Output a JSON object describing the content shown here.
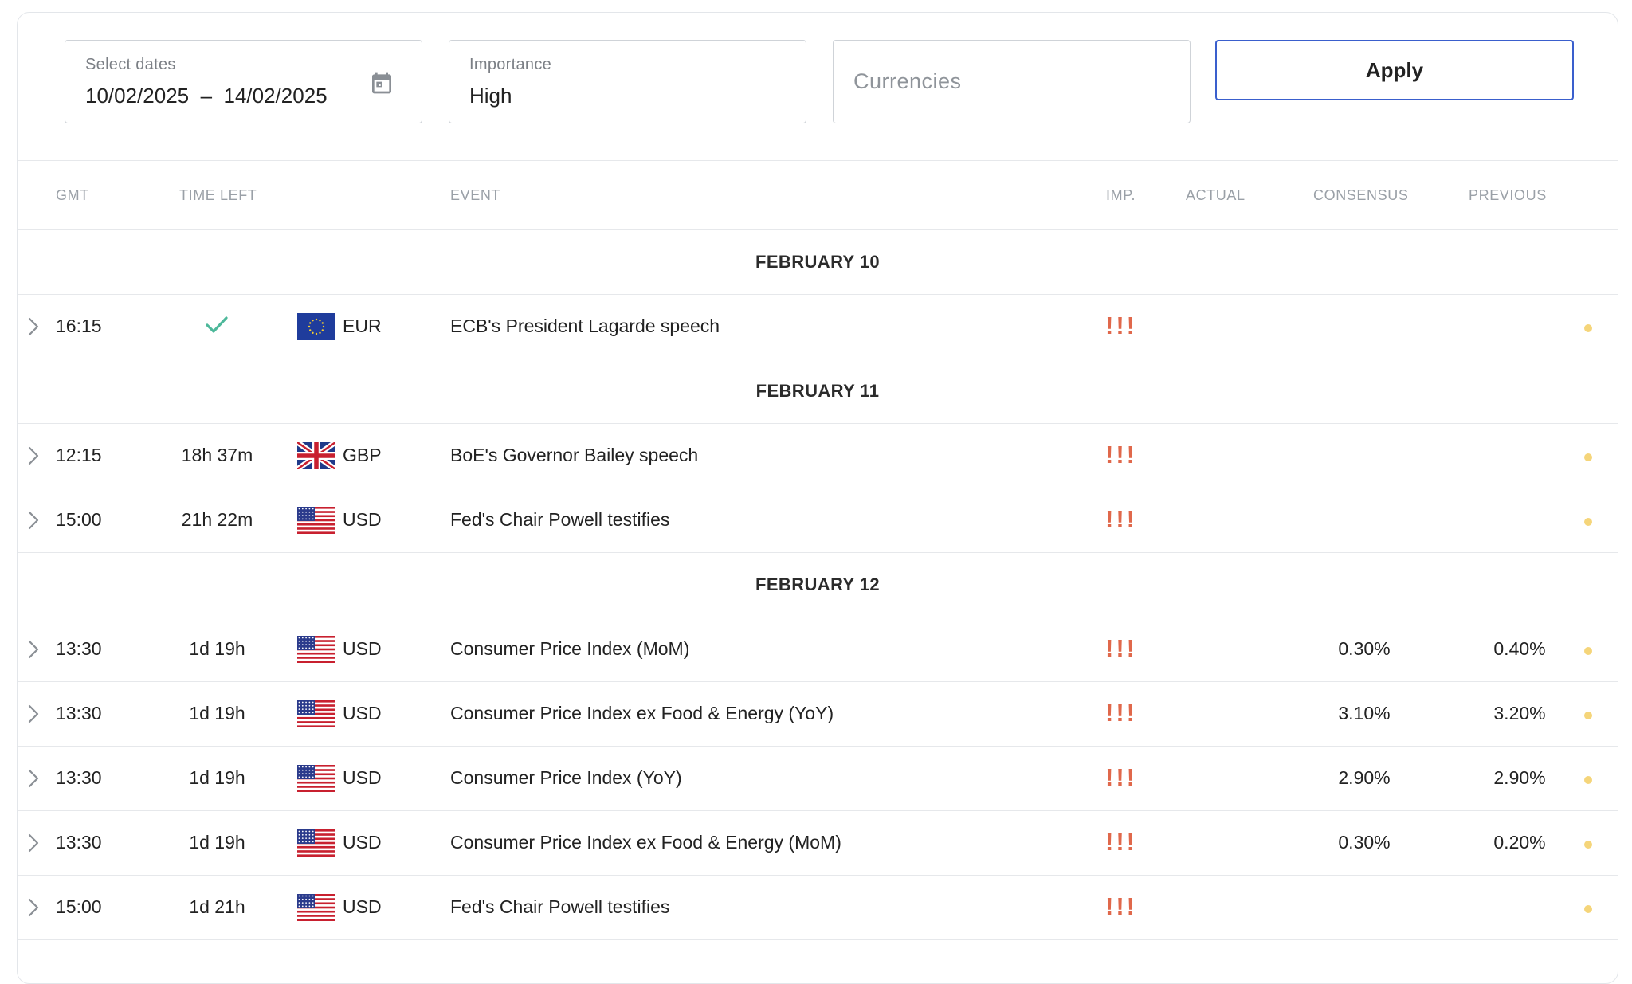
{
  "filters": {
    "dates_label": "Select dates",
    "date_from": "10/02/2025",
    "date_to": "14/02/2025",
    "importance_label": "Importance",
    "importance_value": "High",
    "currencies_placeholder": "Currencies",
    "apply_label": "Apply"
  },
  "columns": {
    "gmt": "GMT",
    "time_left": "TIME LEFT",
    "event": "EVENT",
    "imp": "IMP.",
    "actual": "ACTUAL",
    "consensus": "CONSENSUS",
    "previous": "PREVIOUS"
  },
  "importance_glyph": "!",
  "colors": {
    "accent": "#3a5fcd",
    "importance": "#e0684b",
    "check": "#4db89a",
    "status_dot": "#f5d57a"
  },
  "groups": [
    {
      "date": "FEBRUARY 10",
      "events": [
        {
          "time": "16:15",
          "time_left": "",
          "done": true,
          "flag": "eu",
          "currency": "EUR",
          "event": "ECB's President Lagarde speech",
          "actual": "",
          "consensus": "",
          "previous": ""
        }
      ]
    },
    {
      "date": "FEBRUARY 11",
      "events": [
        {
          "time": "12:15",
          "time_left": "18h 37m",
          "done": false,
          "flag": "gb",
          "currency": "GBP",
          "event": "BoE's Governor Bailey speech",
          "actual": "",
          "consensus": "",
          "previous": ""
        },
        {
          "time": "15:00",
          "time_left": "21h 22m",
          "done": false,
          "flag": "us",
          "currency": "USD",
          "event": "Fed's Chair Powell testifies",
          "actual": "",
          "consensus": "",
          "previous": ""
        }
      ]
    },
    {
      "date": "FEBRUARY 12",
      "events": [
        {
          "time": "13:30",
          "time_left": "1d 19h",
          "done": false,
          "flag": "us",
          "currency": "USD",
          "event": "Consumer Price Index (MoM)",
          "actual": "",
          "consensus": "0.30%",
          "previous": "0.40%"
        },
        {
          "time": "13:30",
          "time_left": "1d 19h",
          "done": false,
          "flag": "us",
          "currency": "USD",
          "event": "Consumer Price Index ex Food & Energy (YoY)",
          "actual": "",
          "consensus": "3.10%",
          "previous": "3.20%"
        },
        {
          "time": "13:30",
          "time_left": "1d 19h",
          "done": false,
          "flag": "us",
          "currency": "USD",
          "event": "Consumer Price Index (YoY)",
          "actual": "",
          "consensus": "2.90%",
          "previous": "2.90%"
        },
        {
          "time": "13:30",
          "time_left": "1d 19h",
          "done": false,
          "flag": "us",
          "currency": "USD",
          "event": "Consumer Price Index ex Food & Energy (MoM)",
          "actual": "",
          "consensus": "0.30%",
          "previous": "0.20%"
        },
        {
          "time": "15:00",
          "time_left": "1d 21h",
          "done": false,
          "flag": "us",
          "currency": "USD",
          "event": "Fed's Chair Powell testifies",
          "actual": "",
          "consensus": "",
          "previous": ""
        }
      ]
    }
  ]
}
